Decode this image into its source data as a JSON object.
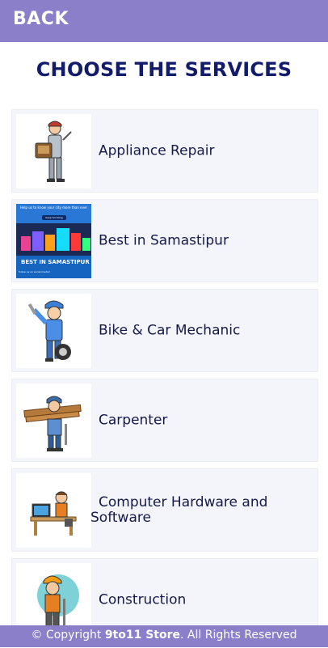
{
  "header": {
    "back_label": "BACK"
  },
  "page": {
    "title": "CHOOSE THE SERVICES"
  },
  "services": [
    {
      "label": "Appliance Repair",
      "icon": "technician-icon"
    },
    {
      "label": "Best in Samastipur",
      "icon": "samastipur-banner-image",
      "banner": {
        "top_text": "Help us to know your city more than ever",
        "button_text": "Keep Scrolling",
        "caption": "BEST IN SAMASTIPUR",
        "sub_caption": "follow us on social media!"
      }
    },
    {
      "label": "Bike & Car Mechanic",
      "icon": "mechanic-icon"
    },
    {
      "label": "Carpenter",
      "icon": "carpenter-icon"
    },
    {
      "label": "Computer Hardware and Software",
      "icon": "computer-technician-icon"
    },
    {
      "label": "Construction",
      "icon": "construction-worker-icon"
    }
  ],
  "footer": {
    "prefix": "© Copyright ",
    "brand": "9to11 Store",
    "suffix": ". All Rights Reserved"
  },
  "colors": {
    "header_bg": "#8a7fc8",
    "title": "#131c6b",
    "card_bg": "#f4f4fb",
    "label": "#151a4a"
  }
}
